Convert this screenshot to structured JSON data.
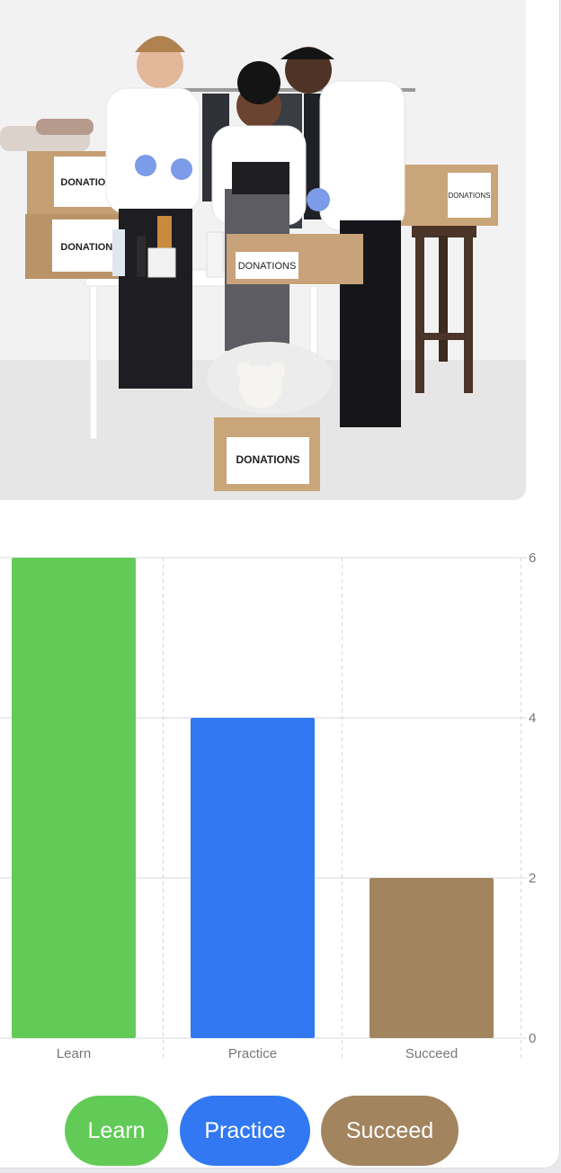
{
  "photo": {
    "alt": "Volunteers packing donation boxes",
    "box_labels": [
      "DONATIONS",
      "DONATIONS",
      "DONATIONS",
      "DONATIONS",
      "DONATIONS"
    ]
  },
  "chart_data": {
    "type": "bar",
    "categories": [
      "Learn",
      "Practice",
      "Succeed"
    ],
    "values": [
      6,
      4,
      2
    ],
    "colors": [
      "#62cb57",
      "#3178f2",
      "#a2845f"
    ],
    "ylim": [
      0,
      6
    ],
    "yticks": [
      "0",
      "2",
      "4",
      "6"
    ],
    "y_axis_side": "right",
    "grid": true
  },
  "legend": {
    "items": [
      {
        "label": "Learn",
        "color": "#62cb57"
      },
      {
        "label": "Practice",
        "color": "#3178f2"
      },
      {
        "label": "Succeed",
        "color": "#a2845f"
      }
    ]
  }
}
